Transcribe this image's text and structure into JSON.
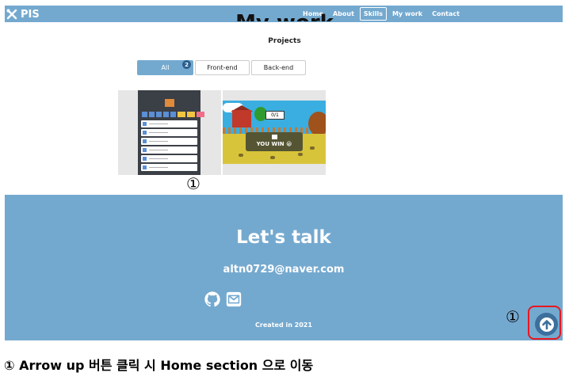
{
  "nav": {
    "logo_text": "PIS",
    "logo_icon": "crossed-tools-icon",
    "links": [
      "Home",
      "About",
      "Skills",
      "My work",
      "Contact"
    ],
    "active_link": "Skills"
  },
  "work": {
    "title": "My work",
    "subtitle": "Projects",
    "filters": [
      "All",
      "Front-end",
      "Back-end"
    ],
    "active_filter": "All",
    "all_count": "2",
    "project_1_marker": "①",
    "project_2": {
      "sign": "0/1",
      "win_text": "YOU WIN 😀"
    }
  },
  "contact": {
    "title": "Let's talk",
    "email": "altn0729@naver.com",
    "icons": [
      "github-icon",
      "envelope-icon"
    ],
    "created": "Created in 2021"
  },
  "arrow_up": {
    "marker": "①",
    "icon": "arrow-up-icon",
    "highlight_color": "#e8171f"
  },
  "caption": "① Arrow up 버튼 클릭 시 Home section 으로 이동",
  "colors": {
    "accent": "#74a9cf",
    "badge": "#2b5f8f",
    "button": "#3d6f9c"
  }
}
